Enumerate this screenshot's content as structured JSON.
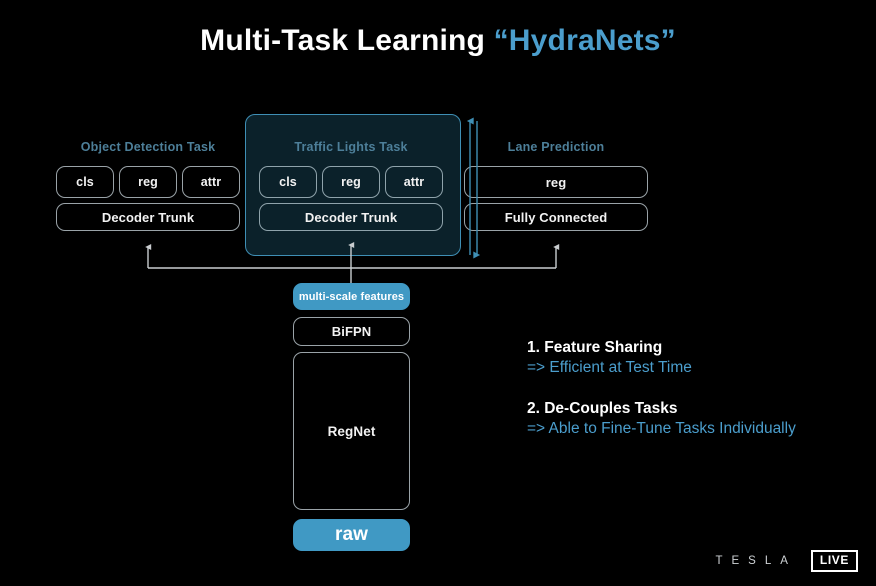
{
  "title": {
    "main": "Multi-Task Learning",
    "highlight": "“HydraNets”"
  },
  "colors": {
    "background": "#000000",
    "accent_blue": "#4099c4",
    "title_blue": "#4b9ecd",
    "label_blue": "#4d7f99",
    "panel_bg": "#0b212a",
    "panel_border": "#3f8fb5",
    "box_border": "#9aa3a8",
    "wire_white": "#c9cdd0",
    "wire_blue": "#3f8fb5",
    "text_white": "#f2f2f2"
  },
  "tasks": [
    {
      "label": "Object Detection Task",
      "highlighted": false,
      "heads": [
        "cls",
        "reg",
        "attr"
      ],
      "trunk": "Decoder Trunk"
    },
    {
      "label": "Traffic Lights Task",
      "highlighted": true,
      "heads": [
        "cls",
        "reg",
        "attr"
      ],
      "trunk": "Decoder Trunk"
    },
    {
      "label": "Lane Prediction",
      "highlighted": false,
      "heads": [
        "reg"
      ],
      "trunk": "Fully Connected"
    }
  ],
  "backbone": [
    {
      "name": "multi-scale features",
      "style": "accent-small"
    },
    {
      "name": "BiFPN",
      "style": "outline"
    },
    {
      "name": "RegNet",
      "style": "outline-tall"
    },
    {
      "name": "raw",
      "style": "accent-big"
    }
  ],
  "notes": [
    {
      "heading": "1. Feature Sharing",
      "detail": "=> Efficient at Test Time"
    },
    {
      "heading": "2. De-Couples Tasks",
      "detail": "=> Able to Fine-Tune Tasks Individually"
    }
  ],
  "footer": {
    "brand": "TESLA",
    "badge": "LIVE"
  }
}
